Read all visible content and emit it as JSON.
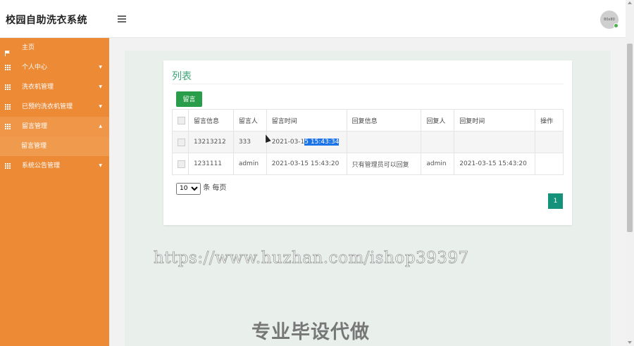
{
  "header": {
    "app_title": "校园自助洗衣系统",
    "avatar_text": "80x80"
  },
  "sidebar": {
    "items": [
      {
        "label": "主页",
        "icon": "flag-icon"
      },
      {
        "label": "个人中心",
        "icon": "grid-icon"
      },
      {
        "label": "洗衣机管理",
        "icon": "grid-icon"
      },
      {
        "label": "已预约洗衣机管理",
        "icon": "grid-icon"
      },
      {
        "label": "留言管理",
        "icon": "grid-icon"
      },
      {
        "label": "系统公告管理",
        "icon": "grid-icon"
      }
    ],
    "submenu": {
      "label": "留言管理"
    }
  },
  "panel": {
    "title": "列表",
    "add_button": "留言"
  },
  "table": {
    "headers": [
      "留言信息",
      "留言人",
      "留言时间",
      "回复信息",
      "回复人",
      "回复时间",
      "操作"
    ],
    "rows": [
      {
        "message": "13213212",
        "author": "333",
        "time_prefix": "2021-03-1",
        "time_selected": "5 15:43:34",
        "reply": "",
        "replier": "",
        "reply_time": "",
        "action": ""
      },
      {
        "message": "1231111",
        "author": "admin",
        "time_prefix": "2021-03-15 15:43:20",
        "time_selected": "",
        "reply": "只有管理员可以回复",
        "replier": "admin",
        "reply_time": "2021-03-15 15:43:20",
        "action": ""
      }
    ]
  },
  "pagination": {
    "page_size": "10",
    "per_page_label": "条 每页",
    "current_page": "1"
  },
  "watermark": {
    "url": "https://www.huzhan.com/ishop39397",
    "text": "专业毕设代做"
  },
  "colors": {
    "sidebar": "#ed8a35",
    "accent_green": "#2a9d4b",
    "page_button": "#14927a",
    "title_green": "#3aa676"
  }
}
